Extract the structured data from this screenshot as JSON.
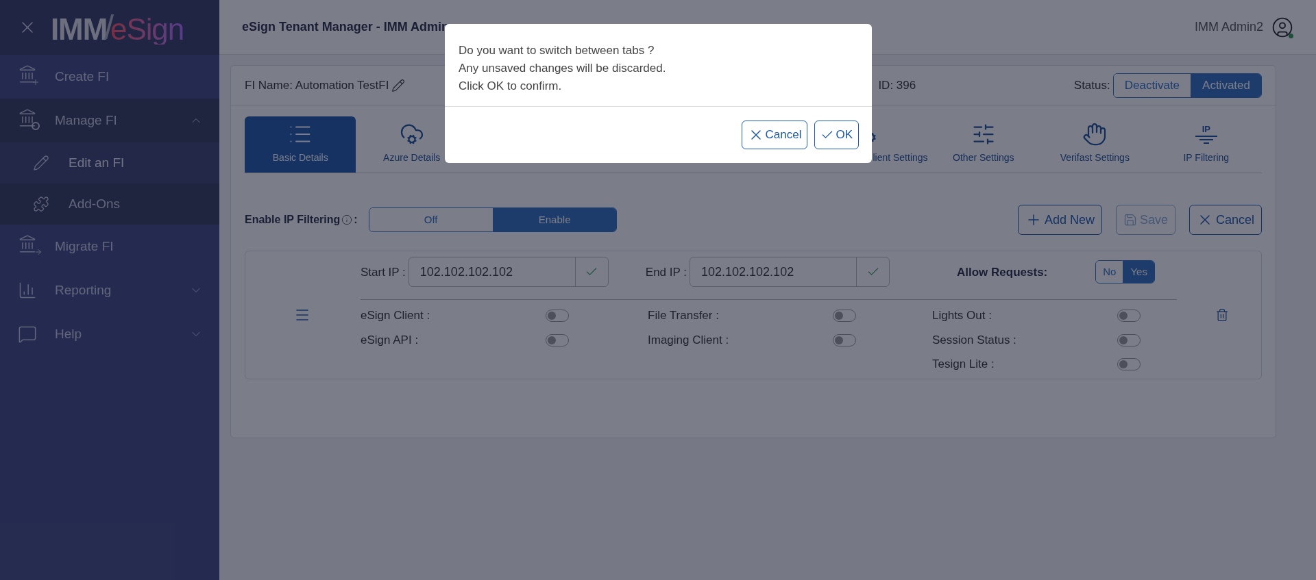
{
  "sidebar": {
    "logo": {
      "part_1": "IMM",
      "separator": "/",
      "part_2": "eSign"
    },
    "items": [
      {
        "label": "Create FI"
      },
      {
        "label": "Manage FI",
        "expanded": true,
        "children": [
          {
            "label": "Edit an FI",
            "selected": true
          },
          {
            "label": "Add-Ons",
            "selected": false
          }
        ]
      },
      {
        "label": "Migrate FI"
      },
      {
        "label": "Reporting",
        "expanded": false
      },
      {
        "label": "Help",
        "expanded": false
      }
    ]
  },
  "header": {
    "title": "eSign Tenant Manager - IMM Admin",
    "user": "IMM Admin2"
  },
  "card": {
    "fi_name": "FI Name: Automation TestFI",
    "fi_id": "ID: 396",
    "status_label": "Status:",
    "status_options": [
      {
        "label": "Deactivate",
        "selected": false
      },
      {
        "label": "Activated",
        "selected": true
      }
    ]
  },
  "tabs": [
    {
      "label": "Basic Details",
      "selected": true
    },
    {
      "label": "Azure Details",
      "selected": false
    },
    {
      "selected": false
    },
    {
      "selected": false
    },
    {
      "selected": false
    },
    {
      "label": "lient Settings",
      "selected": false
    },
    {
      "label": "Other Settings",
      "selected": false
    },
    {
      "label": "Verifast Settings",
      "selected": false
    },
    {
      "label": "IP Filtering",
      "icon_text": "IP",
      "selected": false
    }
  ],
  "ip_filtering": {
    "label": "Enable IP Filtering",
    "colon": ":",
    "options": [
      {
        "label": "Off",
        "selected": false
      },
      {
        "label": "Enable",
        "selected": true
      }
    ],
    "buttons": [
      {
        "label": "Add New",
        "disabled": false
      },
      {
        "label": "Save",
        "disabled": true
      },
      {
        "label": "Cancel",
        "disabled": false
      }
    ],
    "rule": {
      "start_label": "Start IP :",
      "start_value": "102.102.102.102",
      "end_label": "End IP :",
      "end_value": "102.102.102.102",
      "allow_label": "Allow Requests:",
      "allow_options": [
        {
          "label": "No",
          "selected": false
        },
        {
          "label": "Yes",
          "selected": true
        }
      ],
      "toggles": [
        {
          "label": "eSign Client :",
          "on": false
        },
        {
          "label": "File Transfer :",
          "on": false
        },
        {
          "label": "Lights Out :",
          "on": false
        },
        {
          "label": "eSign API :",
          "on": false
        },
        {
          "label": "Imaging Client :",
          "on": false
        },
        {
          "label": "Session Status :",
          "on": false
        },
        {
          "label": "Tesign Lite :",
          "on": false
        }
      ]
    }
  },
  "dialog": {
    "lines": [
      "Do you want to switch between tabs ?",
      "Any unsaved changes will be discarded.",
      "Click OK to confirm."
    ],
    "buttons": [
      {
        "label": "Cancel"
      },
      {
        "label": "OK"
      }
    ]
  }
}
